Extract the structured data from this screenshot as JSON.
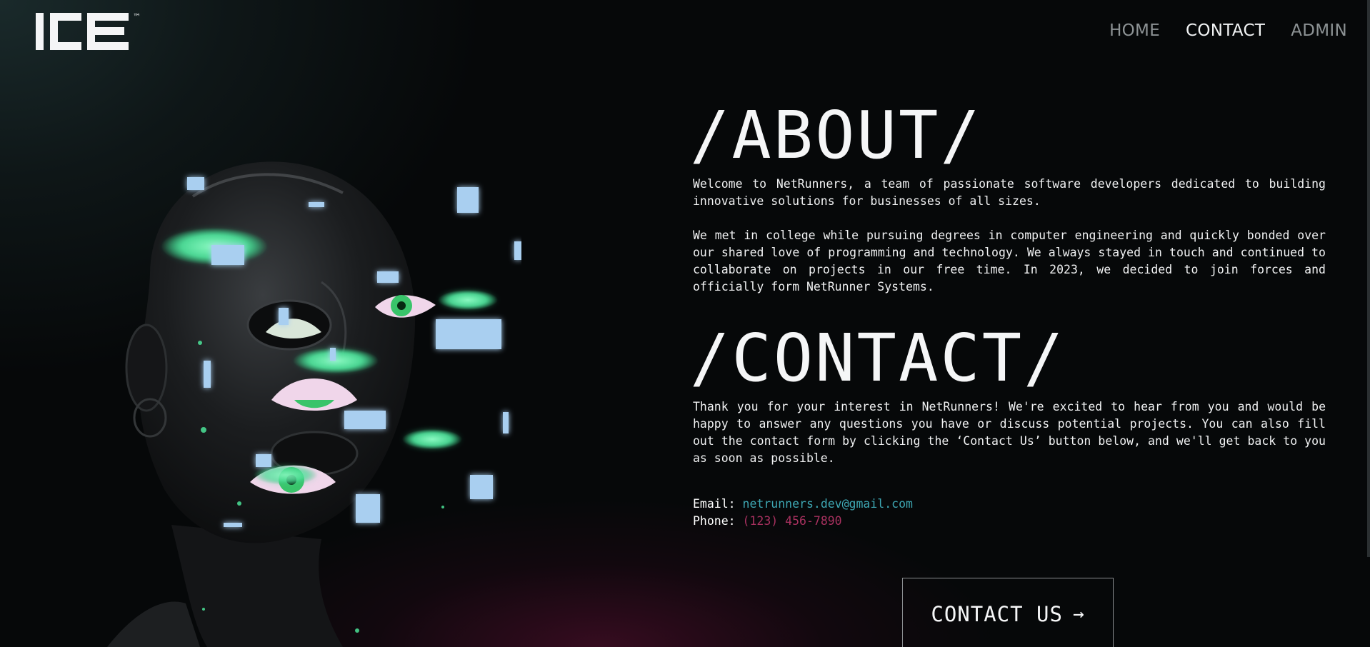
{
  "logo": {
    "text": "ICE",
    "mark": "™"
  },
  "nav": [
    {
      "label": "HOME",
      "active": false
    },
    {
      "label": "CONTACT",
      "active": true
    },
    {
      "label": "ADMIN",
      "active": false
    }
  ],
  "about": {
    "heading": "/ABOUT/",
    "paragraphs": [
      "Welcome to NetRunners, a team of passionate software developers dedicated to building innovative solutions for businesses of all sizes.",
      "We met in college while pursuing degrees in computer engineering and quickly bonded over our shared love of programming and technology. We always stayed in touch and continued to collaborate on projects in our free time. In 2023, we decided to join forces and officially form NetRunner Systems."
    ]
  },
  "contact": {
    "heading": "/CONTACT/",
    "paragraph": "Thank you for your interest in NetRunners! We're excited to hear from you and would be happy to answer any questions you have or discuss potential projects. You can also fill out the contact form by clicking the ‘Contact Us’ button below, and we'll get back to you as soon as possible.",
    "email_label": "Email:",
    "email": "netrunners.dev@gmail.com",
    "phone_label": "Phone:",
    "phone": "(123) 456-7890",
    "button_label": "CONTACT US",
    "button_icon": "arrow-right-icon"
  },
  "colors": {
    "accent_teal": "#3ea7b3",
    "accent_magenta": "#a8315f",
    "glow_green": "#4ff0a0"
  }
}
